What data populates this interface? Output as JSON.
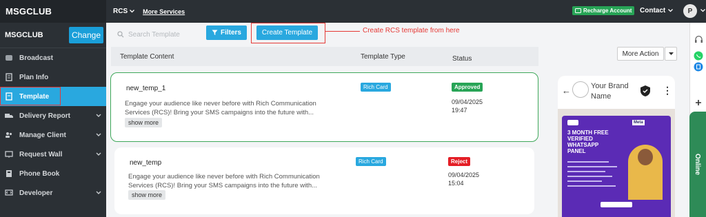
{
  "app": {
    "brand": "MSGCLUB"
  },
  "sidebar": {
    "org_name": "MSGCLUB",
    "change_label": "Change",
    "items": [
      {
        "label": "Broadcast"
      },
      {
        "label": "Plan Info"
      },
      {
        "label": "Template"
      },
      {
        "label": "Delivery Report"
      },
      {
        "label": "Manage Client"
      },
      {
        "label": "Request Wall"
      },
      {
        "label": "Phone Book"
      },
      {
        "label": "Developer"
      }
    ]
  },
  "topbar": {
    "product": "RCS",
    "more_services": "More Services",
    "recharge": "Recharge Account",
    "contact": "Contact",
    "avatar_initial": "P"
  },
  "toolbar": {
    "search_placeholder": "Search Template",
    "filters": "Filters",
    "create_template": "Create Template",
    "annotation": "Create RCS template from here"
  },
  "table": {
    "headers": {
      "content": "Template Content",
      "type": "Template Type",
      "status": "Status"
    },
    "rows": [
      {
        "name": "new_temp_1",
        "desc_line1": "Engage your audience like never before with Rich Communication",
        "desc_line2": "Services (RCS)! Bring your SMS campaigns into the future with...",
        "show_more": "show more",
        "type": "Rich Card",
        "status": "Approved",
        "date": "09/04/2025",
        "time": "19:47"
      },
      {
        "name": "new_temp",
        "desc_line1": "Engage your audience like never before with Rich Communication",
        "desc_line2": "Services (RCS)! Bring your SMS campaigns into the future with...",
        "show_more": "show more",
        "type": "Rich Card",
        "status": "Reject",
        "date": "09/04/2025",
        "time": "15:04"
      }
    ]
  },
  "preview": {
    "more_action": "More Action",
    "brand_name": "Your Brand Name",
    "promo": {
      "badge": "Meta",
      "title_line1": "3 MONTH FREE",
      "title_line2": "VERIFIED",
      "title_line3": "WHATSAPP",
      "title_line4": "PANEL"
    }
  },
  "rail": {
    "online": "Online"
  },
  "colors": {
    "accent": "#29a8df",
    "approved": "#27a456",
    "reject": "#e41e26",
    "highlight": "#e53935"
  }
}
